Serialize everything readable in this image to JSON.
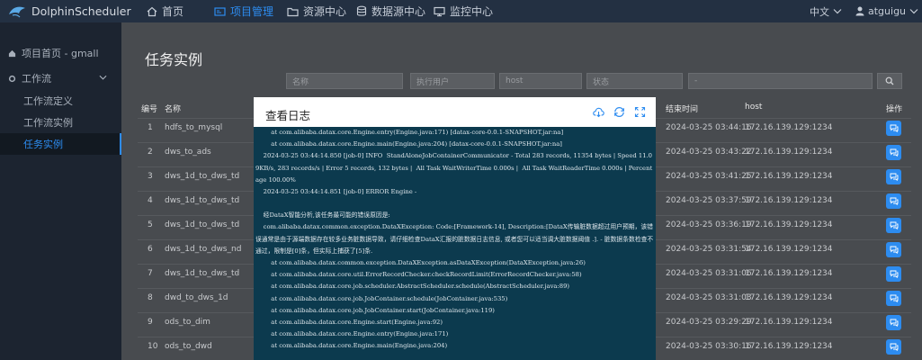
{
  "brand": {
    "name": "DolphinScheduler"
  },
  "nav": {
    "items": [
      {
        "label": "首页",
        "icon": "home-icon",
        "active": false
      },
      {
        "label": "项目管理",
        "icon": "project-icon",
        "active": true
      },
      {
        "label": "资源中心",
        "icon": "folder-icon",
        "active": false
      },
      {
        "label": "数据源中心",
        "icon": "database-icon",
        "active": false
      },
      {
        "label": "监控中心",
        "icon": "monitor-icon",
        "active": false
      }
    ],
    "language": "中文",
    "user": "atguigu"
  },
  "sidebar": {
    "project_home": "项目首页 - gmall",
    "workflow": "工作流",
    "items": [
      {
        "label": "工作流定义",
        "active": false
      },
      {
        "label": "工作流实例",
        "active": false
      },
      {
        "label": "任务实例",
        "active": true
      }
    ]
  },
  "page": {
    "title": "任务实例",
    "filters": {
      "name_placeholder": "名称",
      "executor_placeholder": "执行用户",
      "host_placeholder": "host",
      "state_placeholder": "状态",
      "date_range_value": "-"
    }
  },
  "table": {
    "headers": {
      "no": "编号",
      "name": "名称",
      "end_time": "结束时间",
      "host": "host",
      "ops": "操作"
    },
    "rows": [
      {
        "no": "1",
        "name": "hdfs_to_mysql",
        "end_time": "2024-03-25 03:44:16",
        "host": "172.16.139.129:1234"
      },
      {
        "no": "2",
        "name": "dws_to_ads",
        "end_time": "2024-03-25 03:43:22",
        "host": "172.16.139.129:1234"
      },
      {
        "no": "3",
        "name": "dws_1d_to_dws_td",
        "end_time": "2024-03-25 03:41:25",
        "host": "172.16.139.129:1234"
      },
      {
        "no": "4",
        "name": "dws_1d_to_dws_td",
        "end_time": "2024-03-25 03:37:59",
        "host": "172.16.139.129:1234"
      },
      {
        "no": "5",
        "name": "dws_1d_to_dws_td",
        "end_time": "2024-03-25 03:36:19",
        "host": "172.16.139.129:1234"
      },
      {
        "no": "6",
        "name": "dws_1d_to_dws_nd",
        "end_time": "2024-03-25 03:31:54",
        "host": "172.16.139.129:1234"
      },
      {
        "no": "7",
        "name": "dws_1d_to_dws_td",
        "end_time": "2024-03-25 03:31:06",
        "host": "172.16.139.129:1234"
      },
      {
        "no": "8",
        "name": "dwd_to_dws_1d",
        "end_time": "2024-03-25 03:31:03",
        "host": "172.16.139.129:1234"
      },
      {
        "no": "9",
        "name": "ods_to_dim",
        "end_time": "2024-03-25 03:29:29",
        "host": "172.16.139.129:1234"
      },
      {
        "no": "10",
        "name": "ods_to_dwd",
        "end_time": "2024-03-25 03:30:16",
        "host": "172.16.139.129:1234"
      }
    ]
  },
  "modal": {
    "title": "查看日志",
    "icons": [
      "download-icon",
      "refresh-icon",
      "fullscreen-icon"
    ],
    "log_lines": [
      "        at com.alibaba.datax.core.Engine.entry(Engine.java:171) [datax-core-0.0.1-SNAPSHOT.jar:na]",
      "        at com.alibaba.datax.core.Engine.main(Engine.java:204) [datax-core-0.0.1-SNAPSHOT.jar:na]",
      "    2024-03-25 03:44:14.850 [job-0] INFO  StandAloneJobContainerCommunicator - Total 283 records, 11354 bytes | Speed 11.09KB/s, 283 records/s | Error 5 records, 132 bytes |  All Task WaitWriterTime 0.000s |  All Task WaitReaderTime 0.000s | Percentage 100.00%",
      "    2024-03-25 03:44:14.851 [job-0] ERROR Engine -",
      "",
      "    经DataX智能分析,该任务最可能的错误原因是:",
      "    com.alibaba.datax.common.exception.DataXException: Code:[Framework-14], Description:[DataX传输脏数据超过用户预期，该错误通常是由于源端数据存在较多业务脏数据导致，请仔细检查DataX汇报的脏数据日志信息, 或者您可以适当调大脏数据阈值 .]. - 脏数据条数检查不通过，限制是[0]条，但实际上捕获了[5]条.",
      "        at com.alibaba.datax.common.exception.DataXException.asDataXException(DataXException.java:26)",
      "        at com.alibaba.datax.core.util.ErrorRecordChecker.checkRecordLimit(ErrorRecordChecker.java:58)",
      "        at com.alibaba.datax.core.job.scheduler.AbstractScheduler.schedule(AbstractScheduler.java:89)",
      "        at com.alibaba.datax.core.job.JobContainer.schedule(JobContainer.java:535)",
      "        at com.alibaba.datax.core.job.JobContainer.start(JobContainer.java:119)",
      "        at com.alibaba.datax.core.Engine.start(Engine.java:92)",
      "        at com.alibaba.datax.core.Engine.entry(Engine.java:171)",
      "        at com.alibaba.datax.core.Engine.main(Engine.java:204)"
    ]
  },
  "colors": {
    "accent": "#2d8cf0",
    "topbar": "#233042",
    "sidebar": "#1c2430",
    "log_bg": "#0c3a4e"
  }
}
